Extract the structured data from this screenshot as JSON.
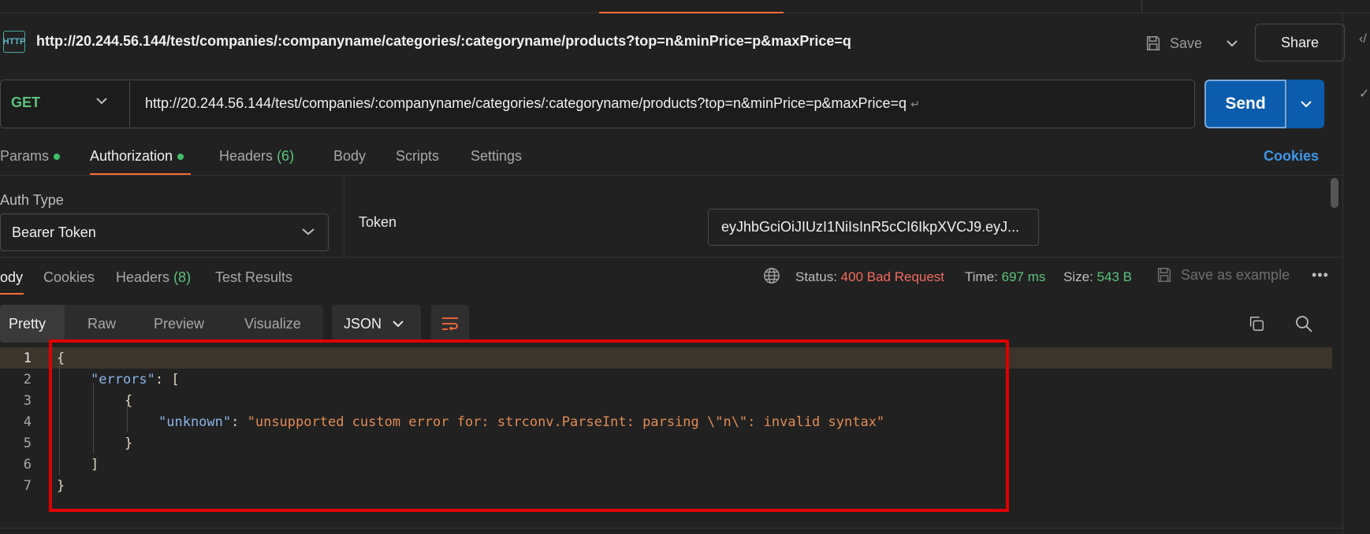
{
  "title_bar": {
    "http_badge": "HTTP",
    "request_title": "http://20.244.56.144/test/companies/:companyname/categories/:categoryname/products?top=n&minPrice=p&maxPrice=q",
    "save_label": "Save",
    "share_label": "Share"
  },
  "request": {
    "method": "GET",
    "url": "http://20.244.56.144/test/companies/:companyname/categories/:categoryname/products?top=n&minPrice=p&maxPrice=q",
    "url_suffix": "↵",
    "send_label": "Send"
  },
  "request_tabs": {
    "params": "Params",
    "authorization": "Authorization",
    "headers": "Headers",
    "headers_count": "(6)",
    "body": "Body",
    "scripts": "Scripts",
    "settings": "Settings",
    "cookies": "Cookies"
  },
  "auth": {
    "type_label": "Auth Type",
    "type_value": "Bearer Token",
    "token_label": "Token",
    "token_value": "eyJhbGciOiJIUzI1NiIsInR5cCI6IkpXVCJ9.eyJ..."
  },
  "response_tabs": {
    "body": "Body",
    "cookies": "Cookies",
    "headers": "Headers",
    "headers_count": "(8)",
    "test_results": "Test Results"
  },
  "response_status": {
    "status_label": "Status:",
    "status_value": "400 Bad Request",
    "time_label": "Time:",
    "time_value": "697 ms",
    "size_label": "Size:",
    "size_value": "543 B",
    "save_example": "Save as example",
    "more": "•••"
  },
  "view_modes": {
    "pretty": "Pretty",
    "raw": "Raw",
    "preview": "Preview",
    "visualize": "Visualize",
    "format": "JSON"
  },
  "code": {
    "line_numbers": [
      "1",
      "2",
      "3",
      "4",
      "5",
      "6",
      "7"
    ],
    "l1": "{",
    "l2_key": "\"errors\"",
    "l2_rest": ": [",
    "l3": "{",
    "l4_key": "\"unknown\"",
    "l4_colon": ": ",
    "l4_val": "\"unsupported custom error for: strconv.ParseInt: parsing \\\"n\\\": invalid syntax\"",
    "l5": "}",
    "l6": "]",
    "l7": "}"
  },
  "colors": {
    "accent": "#ff6c37",
    "send_blue": "#0b5cad",
    "status_error": "#f36b5e",
    "status_ok": "#5cc37d",
    "annotation_red": "#e00000"
  }
}
